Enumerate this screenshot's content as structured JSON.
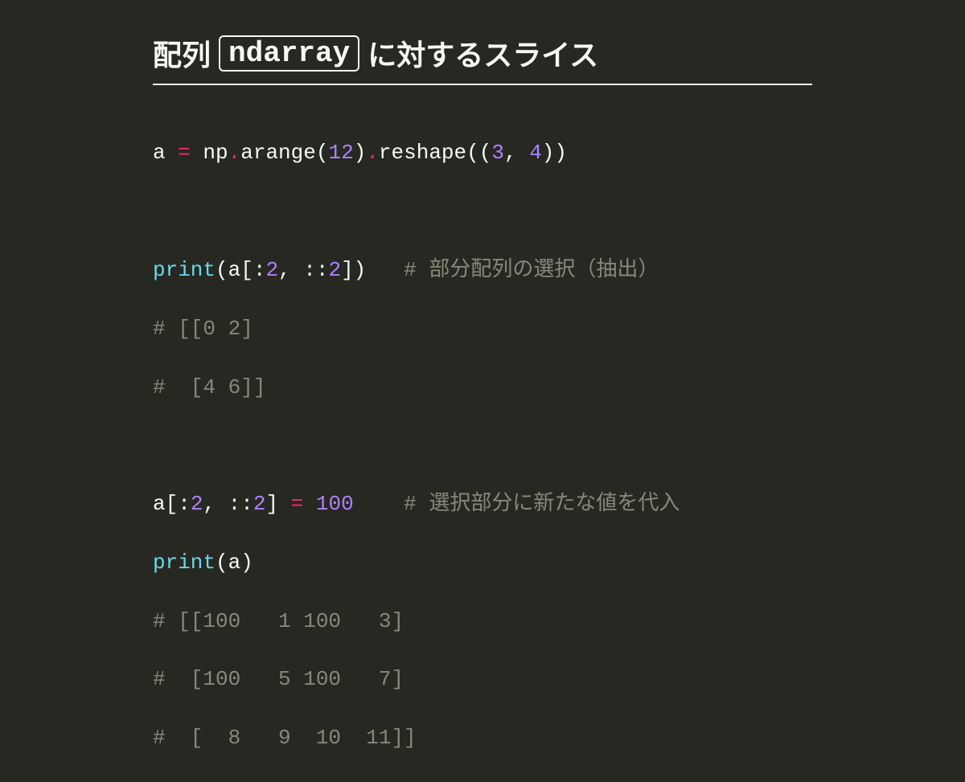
{
  "title": {
    "prefix": "配列",
    "badge": "ndarray",
    "suffix": "に対するスライス"
  },
  "code": {
    "line1": {
      "a": "a",
      "eq": " = ",
      "np": "np",
      "dot1": ".",
      "arange": "arange",
      "p1": "(",
      "twelve": "12",
      "p2": ")",
      "dot2": ".",
      "reshape": "reshape",
      "p3": "((",
      "three": "3",
      "comma": ", ",
      "four": "4",
      "p4": "))"
    },
    "line3": {
      "print": "print",
      "p1": "(a[:",
      "two": "2",
      "sep": ", ::",
      "two2": "2",
      "p2": "])",
      "pad": "   ",
      "comment": "# 部分配列の選択（抽出）"
    },
    "line4": "# [[0 2]",
    "line5": "#  [4 6]]",
    "line7": {
      "a": "a[:",
      "two": "2",
      "sep": ", ::",
      "two2": "2",
      "p2": "]",
      "eq": " = ",
      "hundred": "100",
      "pad": "    ",
      "comment": "# 選択部分に新たな値を代入"
    },
    "line8": {
      "print": "print",
      "p1": "(a)"
    },
    "line9": "# [[100   1 100   3]",
    "line10": "#  [100   5 100   7]",
    "line11": "#  [  8   9  10  11]]"
  }
}
